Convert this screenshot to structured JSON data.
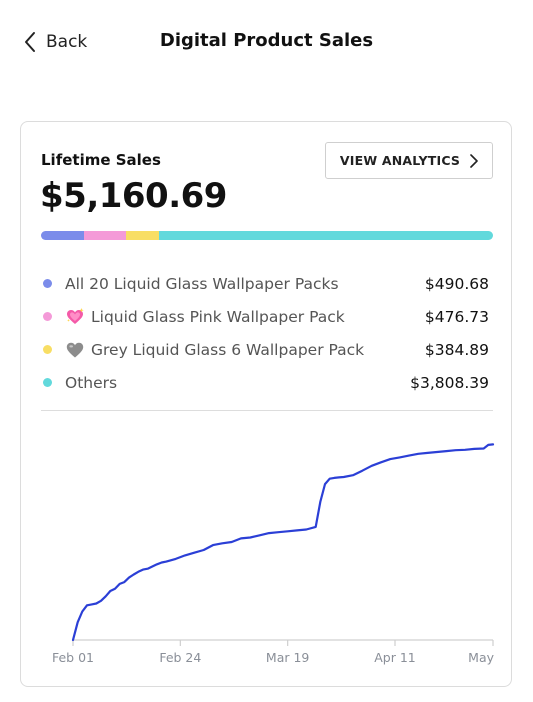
{
  "header": {
    "back_label": "Back",
    "title": "Digital Product Sales"
  },
  "card": {
    "label": "Lifetime Sales",
    "total": "$5,160.69",
    "analytics_button": "VIEW ANALYTICS",
    "legend": [
      {
        "name": "All 20 Liquid Glass Wallpaper Packs",
        "value": "$490.68",
        "color": "#7b8cea",
        "icon": ""
      },
      {
        "name": "Liquid Glass Pink Wallpaper Pack",
        "value": "$476.73",
        "color": "#f49ad8",
        "icon": "sparkling-heart-emoji"
      },
      {
        "name": "Grey Liquid Glass 6 Wallpaper Pack",
        "value": "$384.89",
        "color": "#f8de64",
        "icon": "grey-heart-emoji"
      },
      {
        "name": "Others",
        "value": "$3,808.39",
        "color": "#62d9dc",
        "icon": ""
      }
    ]
  },
  "chart_data": {
    "type": "line",
    "title": "",
    "xlabel": "",
    "ylabel": "",
    "tick_labels": [
      "Feb 01",
      "Feb 24",
      "Mar 19",
      "Apr 11",
      "May"
    ],
    "ticks_day": [
      0,
      23,
      46,
      69,
      90
    ],
    "x_domain": [
      0,
      90
    ],
    "line_color": "#2b3fd6",
    "grid": false,
    "series": [
      {
        "x": [
          0,
          1,
          2,
          3,
          4,
          5,
          6,
          7,
          8,
          9,
          10,
          11,
          12,
          13,
          14,
          15,
          16,
          17,
          18,
          19,
          20,
          22,
          24,
          26,
          28,
          30,
          32,
          34,
          36,
          38,
          40,
          42,
          44,
          46,
          48,
          50,
          52,
          53,
          54,
          55,
          56,
          57,
          58,
          60,
          62,
          64,
          66,
          68,
          70,
          72,
          74,
          76,
          78,
          80,
          82,
          84,
          86,
          88,
          89,
          90
        ],
        "y": [
          0,
          400,
          640,
          780,
          800,
          820,
          880,
          980,
          1100,
          1150,
          1260,
          1300,
          1400,
          1470,
          1530,
          1580,
          1600,
          1650,
          1700,
          1740,
          1760,
          1820,
          1900,
          1960,
          2020,
          2130,
          2170,
          2200,
          2280,
          2300,
          2350,
          2400,
          2420,
          2440,
          2460,
          2480,
          2540,
          3100,
          3500,
          3620,
          3640,
          3650,
          3660,
          3700,
          3800,
          3910,
          3990,
          4060,
          4100,
          4140,
          4180,
          4200,
          4220,
          4240,
          4260,
          4270,
          4290,
          4300,
          4380,
          4390
        ]
      }
    ]
  }
}
